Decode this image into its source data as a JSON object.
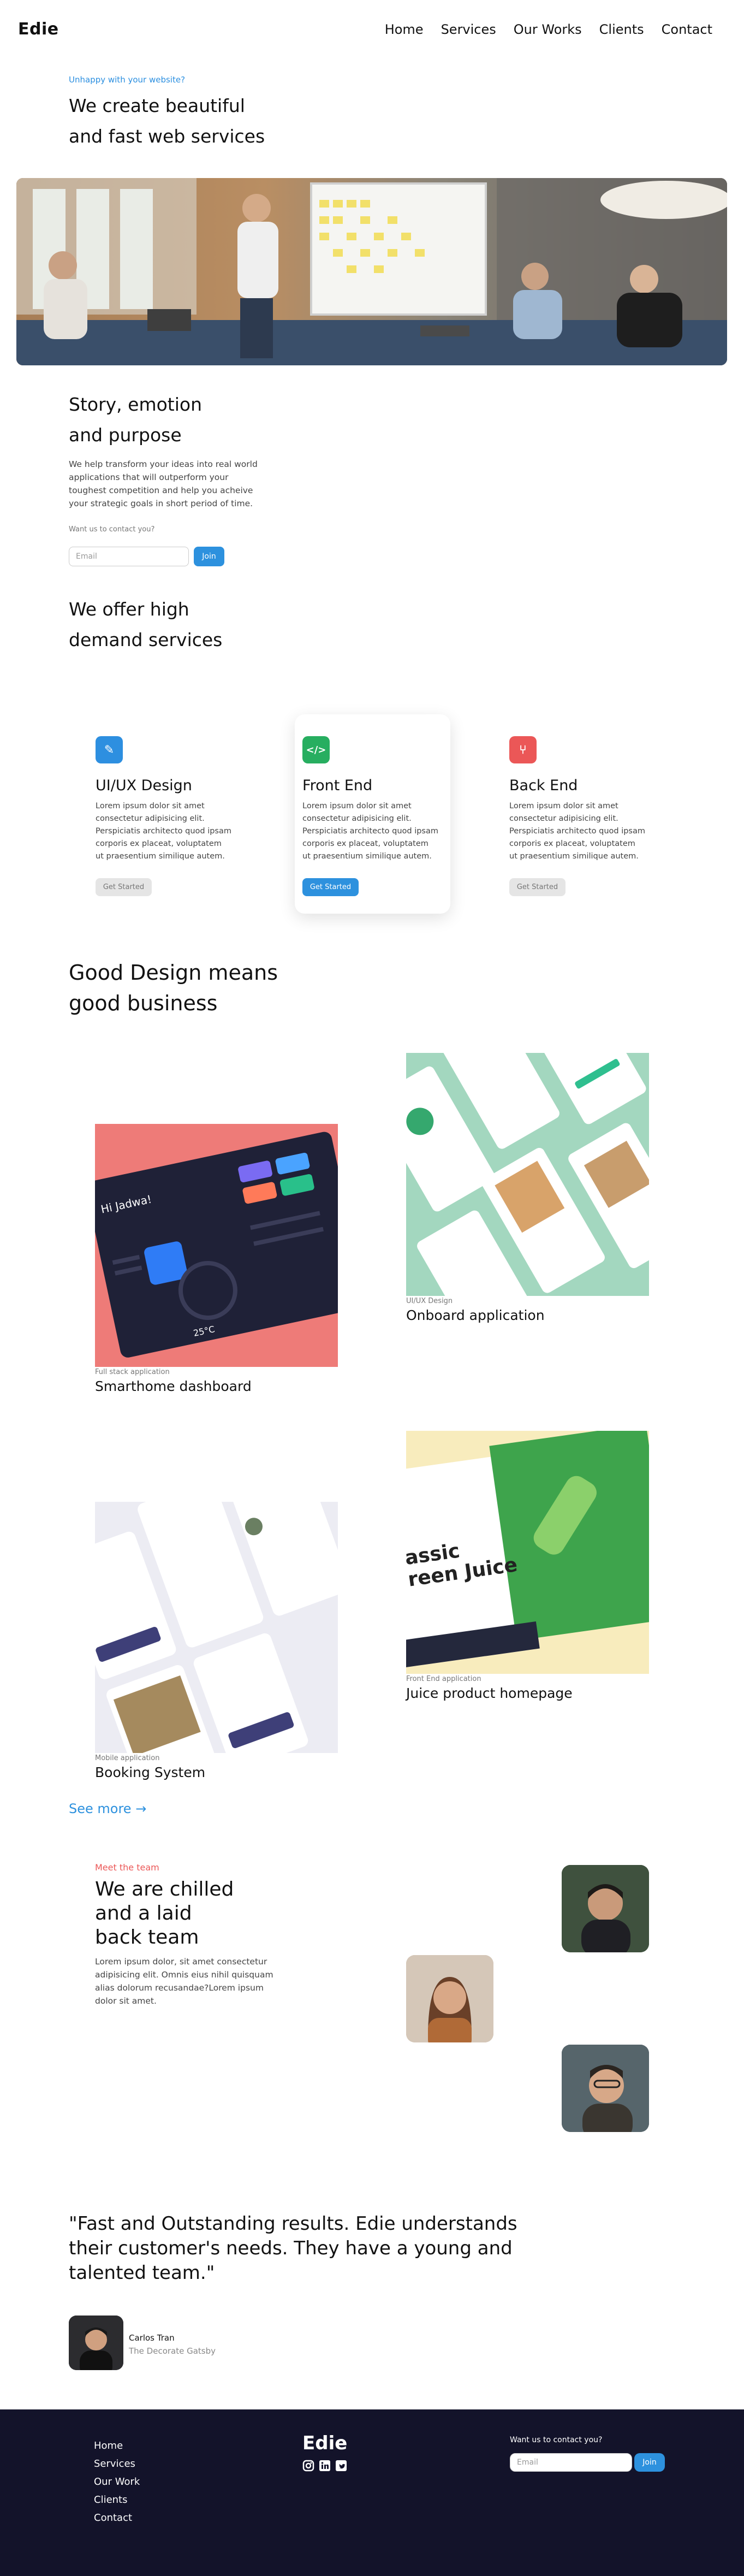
{
  "nav": {
    "logo": "Edie",
    "items": [
      "Home",
      "Services",
      "Our Works",
      "Clients",
      "Contact"
    ]
  },
  "hero": {
    "eyebrow": "Unhappy with your website?",
    "title_line1": "We create beautiful",
    "title_line2": "and fast web services"
  },
  "story": {
    "title_line1": "Story, emotion",
    "title_line2": "and purpose",
    "text": "We help transform your ideas into real world applications that will outperform your toughest competition and help you acheive your strategic goals in short period of time.",
    "contact_prompt": "Want us to contact you?",
    "email_placeholder": "Email",
    "join_label": "Join"
  },
  "services": {
    "title_line1": "We offer high",
    "title_line2": "demand services",
    "items": [
      {
        "title": "UI/UX Design",
        "desc": "Lorem ipsum dolor sit amet consectetur adipisicing elit. Perspiciatis architecto quod ipsam corporis ex placeat, voluptatem ut praesentium similique autem.",
        "button": "Get Started",
        "icon": "pen-icon",
        "color": "#2d8fe0"
      },
      {
        "title": "Front End",
        "desc": "Lorem ipsum dolor sit amet consectetur adipisicing elit. Perspiciatis architecto quod ipsam corporis ex placeat, voluptatem ut praesentium similique autem.",
        "button": "Get Started",
        "icon": "code-icon",
        "color": "#27ae60"
      },
      {
        "title": "Back End",
        "desc": "Lorem ipsum dolor sit amet consectetur adipisicing elit. Perspiciatis architecto quod ipsam corporis ex placeat, voluptatem ut praesentium similique autem.",
        "button": "Get Started",
        "icon": "branch-icon",
        "color": "#eb5757"
      }
    ]
  },
  "works": {
    "title_line1": "Good Design means",
    "title_line2": "good business",
    "items": [
      {
        "category": "UI/UX Design",
        "name": "Onboard application"
      },
      {
        "category": "Full stack application",
        "name": "Smarthome dashboard"
      },
      {
        "category": "Front End application",
        "name": "Juice product homepage"
      },
      {
        "category": "Mobile application",
        "name": "Booking System"
      }
    ],
    "juice_text_1": "assic",
    "juice_text_2": "reen Juice",
    "smarthome_greet": "Hi Jadwa!",
    "smarthome_temp": "25°C",
    "see_more": "See more →"
  },
  "team": {
    "eyebrow": "Meet the team",
    "title_line1": "We are chilled",
    "title_line2": "and a laid",
    "title_line3": "back team",
    "text": "Lorem ipsum dolor, sit amet consectetur adipisicing elit. Omnis eius nihil quisquam alias dolorum recusandae?Lorem ipsum dolor sit amet."
  },
  "testimonial": {
    "quote": "\"Fast and Outstanding results. Edie understands their customer's needs. They have a young and talented team.\"",
    "name": "Carlos Tran",
    "company": "The Decorate Gatsby"
  },
  "footer": {
    "links": [
      "Home",
      "Services",
      "Our Work",
      "Clients",
      "Contact"
    ],
    "logo": "Edie",
    "social_icons": [
      "instagram-icon",
      "linkedin-icon",
      "twitter-icon"
    ],
    "contact_prompt": "Want us to contact you?",
    "email_placeholder": "Email",
    "join_label": "Join"
  },
  "colors": {
    "accent": "#2d91de",
    "team_eyebrow": "#eb5757",
    "footer_bg": "#13132a"
  }
}
